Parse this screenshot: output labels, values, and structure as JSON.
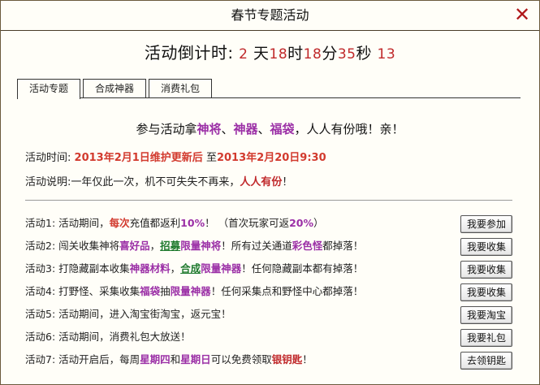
{
  "window": {
    "title": "春节专题活动"
  },
  "countdown": {
    "label": "活动倒计时:",
    "days": "2",
    "days_unit": "天",
    "hours": "18",
    "hours_unit": "时",
    "minutes": "18",
    "minutes_unit": "分",
    "seconds": "35",
    "seconds_unit": "秒",
    "extra": "13"
  },
  "tabs": [
    {
      "label": "活动专题",
      "active": true
    },
    {
      "label": "合成神器",
      "active": false
    },
    {
      "label": "消费礼包",
      "active": false
    }
  ],
  "headline": {
    "prefix": "参与活动拿",
    "item1": "神将",
    "sep1": "、",
    "item2": "神器",
    "sep2": "、",
    "item3": "福袋",
    "suffix": "，人人有份哦！亲！"
  },
  "event_time": {
    "label": "活动时间:",
    "start": "2013年2月1日维护更新后",
    "to": "至",
    "end": "2013年2月20日9:30"
  },
  "event_desc": {
    "label": "活动说明:",
    "text": "一年仅此一次，机不可失失不再来，",
    "highlight": "人人有份",
    "end": "！"
  },
  "activities": [
    {
      "parts": [
        "活动1: 活动期间，",
        "每次",
        "充值都返利",
        "10%",
        "！ （首次玩家可返",
        "20%",
        "）"
      ],
      "button": "我要参加"
    },
    {
      "parts": [
        "活动2: 闯关收集神将",
        "喜好品",
        "，",
        "招募",
        "限量神将",
        "！所有过关通道",
        "彩色怪",
        "都掉落！"
      ],
      "button": "我要收集"
    },
    {
      "parts": [
        "活动3: 打隐藏副本收集",
        "神器材料",
        "，",
        "合成",
        "限量神器",
        "！任何隐藏副本都有掉落！"
      ],
      "button": "我要收集"
    },
    {
      "parts": [
        "活动4: 打野怪、采集收集",
        "福袋",
        "抽",
        "限量神器",
        "！任何采集点和野怪中心都掉落！"
      ],
      "button": "我要收集"
    },
    {
      "parts": [
        "活动5: 活动期间，进入淘宝街淘宝，返元宝！"
      ],
      "button": "我要淘宝"
    },
    {
      "parts": [
        "活动6: 活动期间，消费礼包大放送！"
      ],
      "button": "我要礼包"
    },
    {
      "parts": [
        "活动7: 活动开启后，每周",
        "星期四",
        "和",
        "星期日",
        "可以免费领取",
        "银钥匙",
        "！"
      ],
      "button": "去领钥匙"
    }
  ],
  "colors": {
    "accent_red": "#d23a2e",
    "accent_purple": "#9b2fa6",
    "accent_green": "#1f7a2e",
    "close_icon": "#b0181a"
  }
}
